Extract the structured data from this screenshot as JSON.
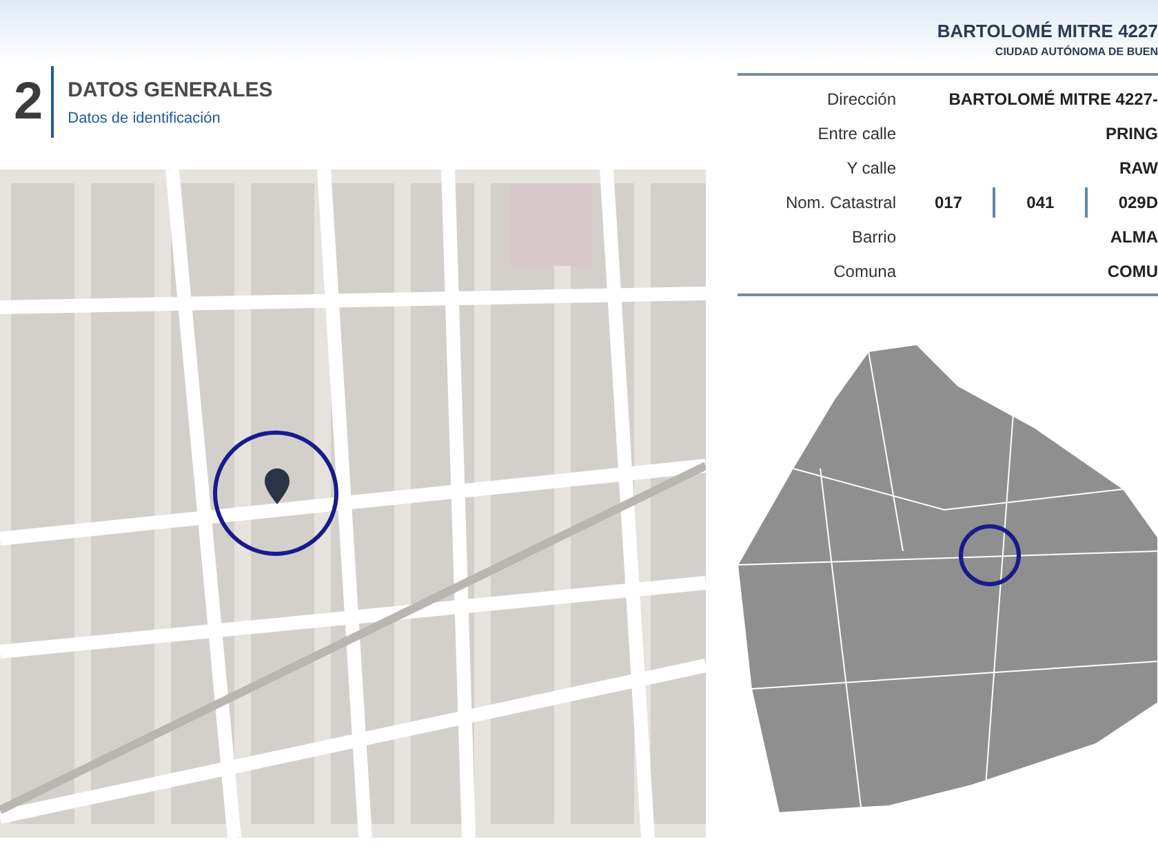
{
  "header": {
    "title": "BARTOLOMÉ MITRE 4227",
    "subtitle": "CIUDAD AUTÓNOMA DE BUEN"
  },
  "section": {
    "number": "2",
    "title": "DATOS GENERALES",
    "subtitle": "Datos de identificación"
  },
  "details": [
    {
      "label": "Dirección",
      "values": [
        "BARTOLOMÉ MITRE 4227-"
      ]
    },
    {
      "label": "Entre calle",
      "values": [
        "PRING"
      ]
    },
    {
      "label": "Y calle",
      "values": [
        "RAW"
      ]
    },
    {
      "label": "Nom. Catastral",
      "values": [
        "017",
        "041",
        "029D"
      ]
    },
    {
      "label": "Barrio",
      "values": [
        "ALMA"
      ]
    },
    {
      "label": "Comuna",
      "values": [
        "COMU"
      ]
    }
  ]
}
